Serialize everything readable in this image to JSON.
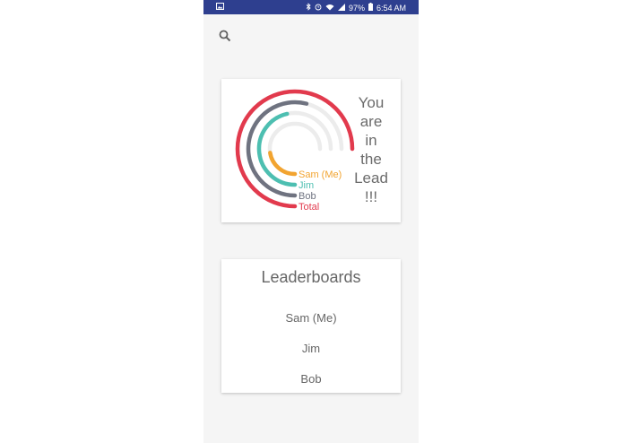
{
  "status_bar": {
    "left_icon": "image-icon",
    "icons": [
      "bluetooth-icon",
      "alarm-icon",
      "wifi-icon",
      "signal-icon"
    ],
    "battery": "97%",
    "time": "6:54 AM"
  },
  "toolbar": {
    "search_icon": "search-icon"
  },
  "lead_card": {
    "message_lines": [
      "You",
      "are",
      "in",
      "the",
      "Lead",
      "!!!"
    ]
  },
  "chart_data": {
    "type": "radial-bar",
    "series": [
      {
        "name": "Sam (Me)",
        "color": "#f2a430",
        "value": 0.3
      },
      {
        "name": "Jim",
        "color": "#4dbfb1",
        "value": 0.62
      },
      {
        "name": "Bob",
        "color": "#6f7380",
        "value": 0.72
      },
      {
        "name": "Total",
        "color": "#e23a4d",
        "value": 1.0
      }
    ],
    "track_color": "#ececec"
  },
  "leaderboards": {
    "title": "Leaderboards",
    "items": [
      "Sam (Me)",
      "Jim",
      "Bob"
    ]
  }
}
